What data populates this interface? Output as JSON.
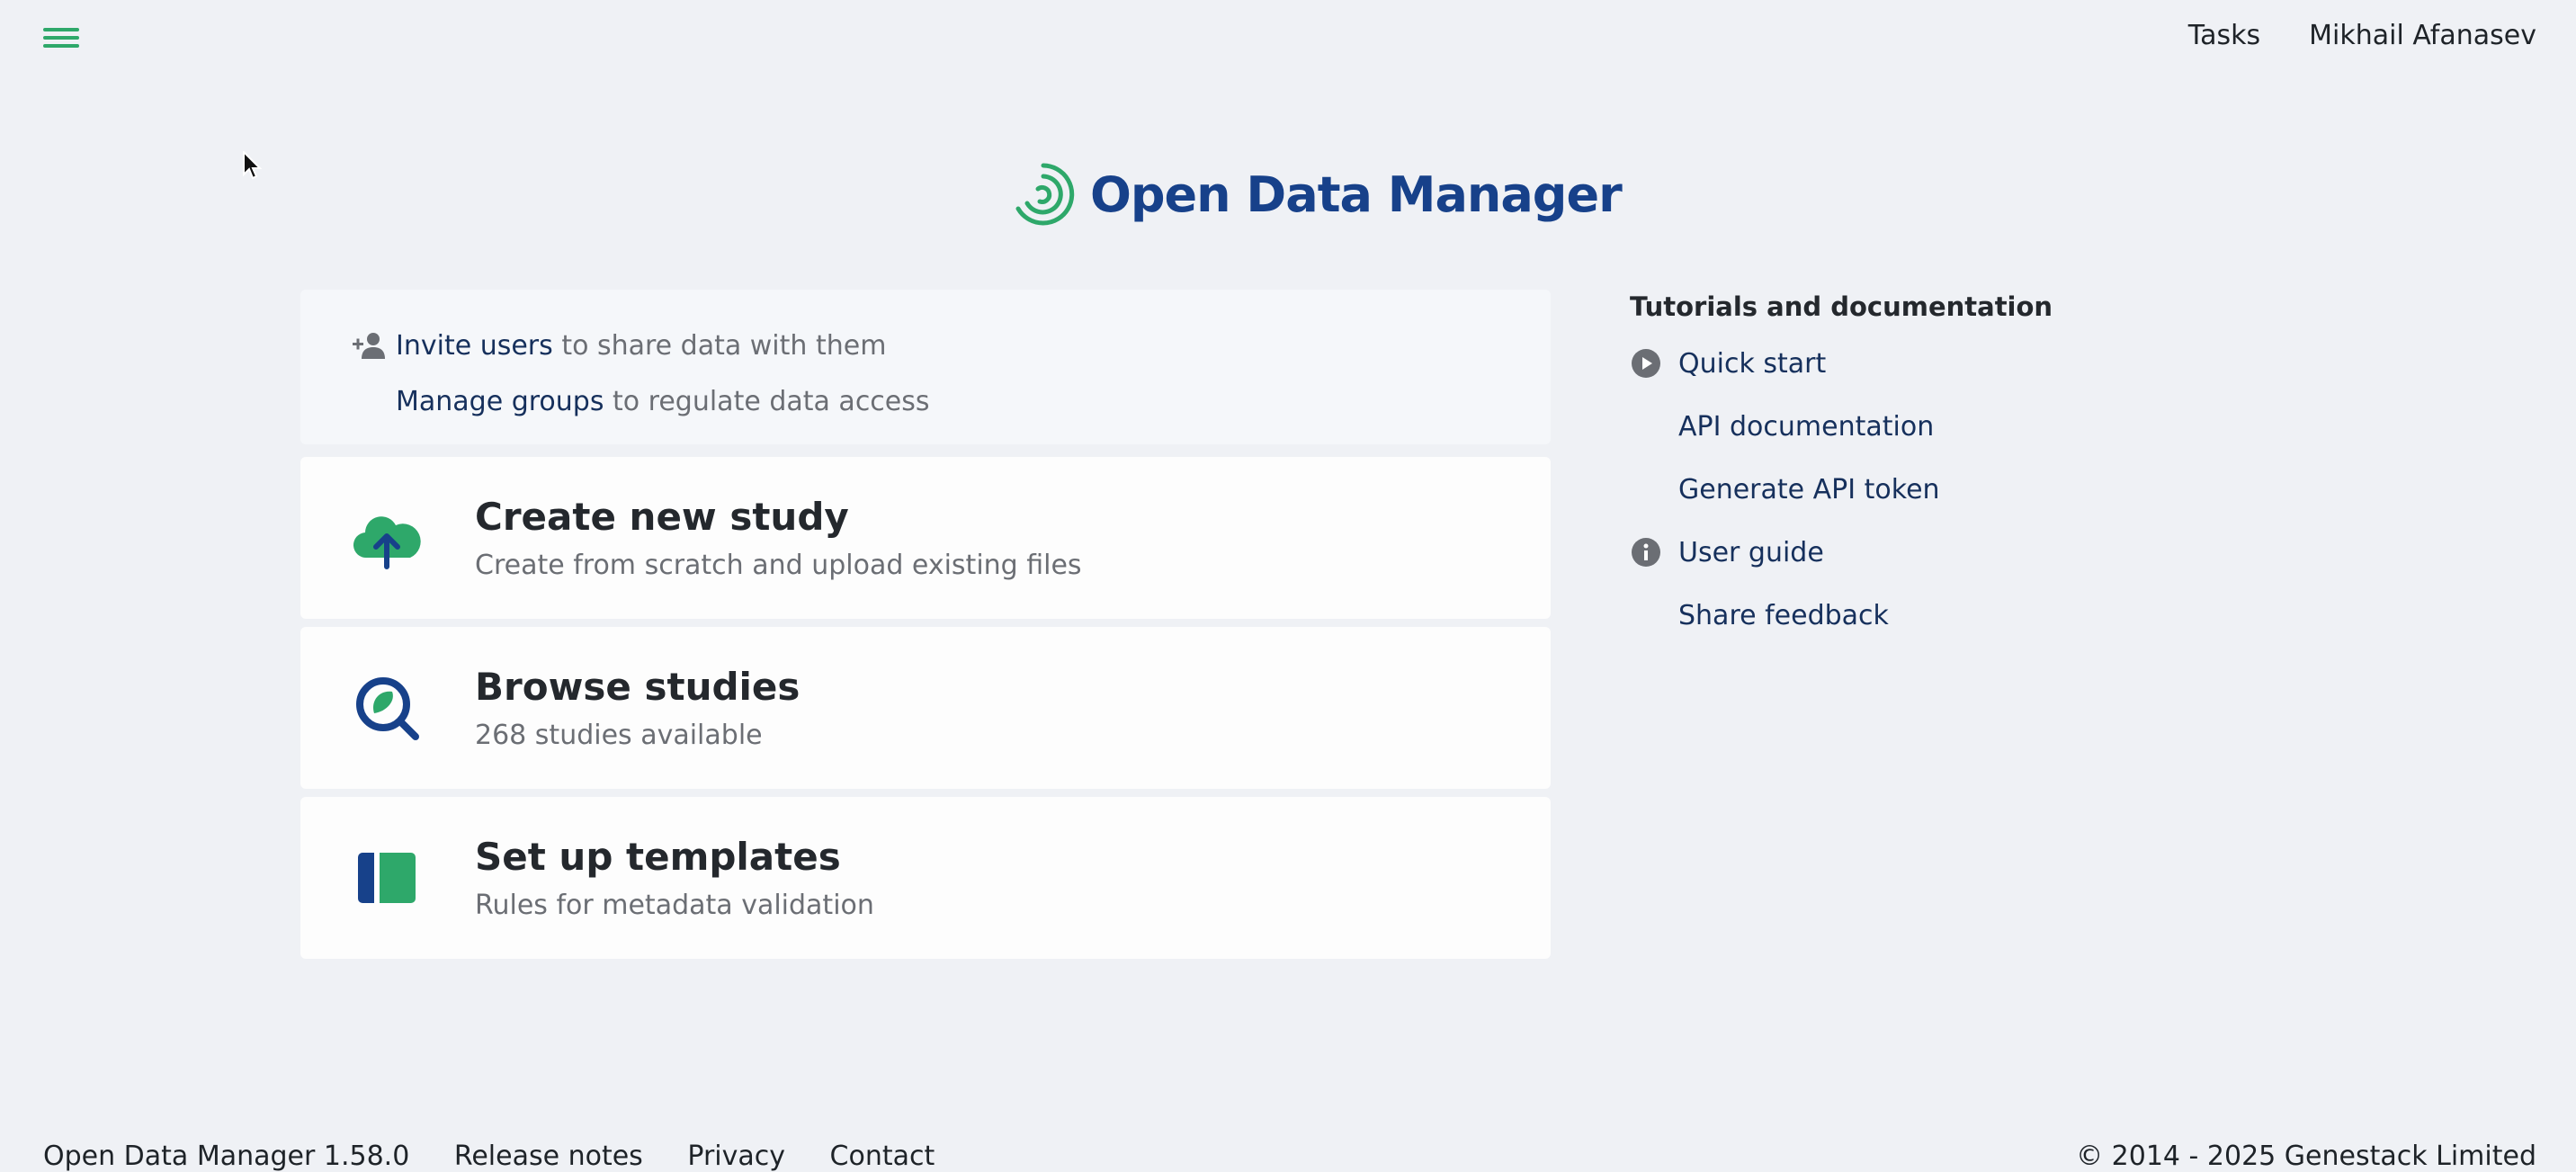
{
  "topnav": {
    "tasks": "Tasks",
    "user": "Mikhail Afanasev"
  },
  "logo": {
    "text": "Open Data Manager"
  },
  "invite": {
    "users_link": "Invite users",
    "users_text": " to share data with them",
    "groups_link": "Manage groups",
    "groups_text": " to regulate data access"
  },
  "cards": [
    {
      "title": "Create new study",
      "subtitle": "Create from scratch and upload existing files"
    },
    {
      "title": "Browse studies",
      "subtitle": "268 studies available"
    },
    {
      "title": "Set up templates",
      "subtitle": "Rules for metadata validation"
    }
  ],
  "docs": {
    "heading": "Tutorials and documentation",
    "items": [
      "Quick start",
      "API documentation",
      "Generate API token",
      "User guide",
      "Share feedback"
    ]
  },
  "footer": {
    "version": "Open Data Manager 1.58.0",
    "release_notes": "Release notes",
    "privacy": "Privacy",
    "contact": "Contact",
    "copyright": "© 2014 - 2025 Genestack Limited"
  },
  "colors": {
    "accent_green": "#2ea86a",
    "brand_blue": "#17418a",
    "link": "#16305c"
  }
}
